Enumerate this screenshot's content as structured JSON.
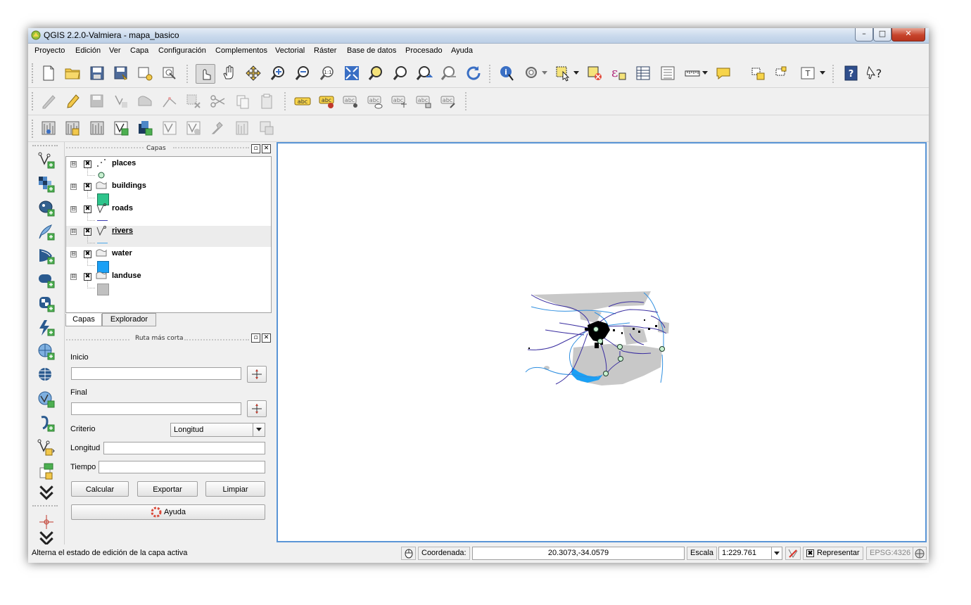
{
  "window": {
    "title": "QGIS 2.2.0-Valmiera - mapa_basico",
    "controls": {
      "minimize": "–",
      "maximize": "□",
      "close": "✕"
    }
  },
  "menubar": [
    "Proyecto",
    "Edición",
    "Ver",
    "Capa",
    "Configuración",
    "Complementos",
    "Vectorial",
    "Ráster",
    "Base de datos",
    "Procesado",
    "Ayuda"
  ],
  "toolbars": {
    "labels": [
      "abc",
      "abc",
      "abc",
      "abc",
      "abc",
      "abc",
      "abc"
    ],
    "help_glyph": "?",
    "whats_this": "?"
  },
  "layers_panel": {
    "title": "Capas",
    "layers": [
      {
        "name": "places",
        "checked": true,
        "expander": "⊟",
        "legend_color": "#c8f0d0"
      },
      {
        "name": "buildings",
        "checked": true,
        "expander": "⊟",
        "legend_color": "#2ec48b"
      },
      {
        "name": "roads",
        "checked": true,
        "expander": "⊟",
        "legend_color": "#3b3bb0"
      },
      {
        "name": "rivers",
        "checked": true,
        "expander": "⊟",
        "legend_color": "#4aa7e8"
      },
      {
        "name": "water",
        "checked": true,
        "expander": "⊟",
        "legend_color": "#1aa0f5"
      },
      {
        "name": "landuse",
        "checked": true,
        "expander": "⊟",
        "legend_color": "#c0c0c0"
      }
    ],
    "check_glyph": "✖",
    "tabs": [
      "Capas",
      "Explorador"
    ]
  },
  "route_panel": {
    "title": "Ruta más corta",
    "start_label": "Inicio",
    "start_value": "",
    "end_label": "Final",
    "end_value": "",
    "criteria_label": "Criterio",
    "criteria_value": "Longitud",
    "length_label": "Longitud",
    "length_value": "",
    "time_label": "Tiempo",
    "time_value": "",
    "calc_button": "Calcular",
    "export_button": "Exportar",
    "clear_button": "Limpiar",
    "help_button": "Ayuda"
  },
  "statusbar": {
    "message": "Alterna el estado de edición de la capa activa",
    "coord_label": "Coordenada:",
    "coord_value": "20.3073,-34.0579",
    "scale_label": "Escala",
    "scale_value": "1:229.761",
    "render_label": "Representar",
    "render_checked": true,
    "crs": "EPSG:4326"
  },
  "colors": {
    "canvas_border": "#5a95d6",
    "roads": "#3a2ea0",
    "rivers": "#2f8fe0",
    "landuse": "#c8c8c8",
    "buildings": "#000000",
    "places": "#c8f0d0"
  }
}
